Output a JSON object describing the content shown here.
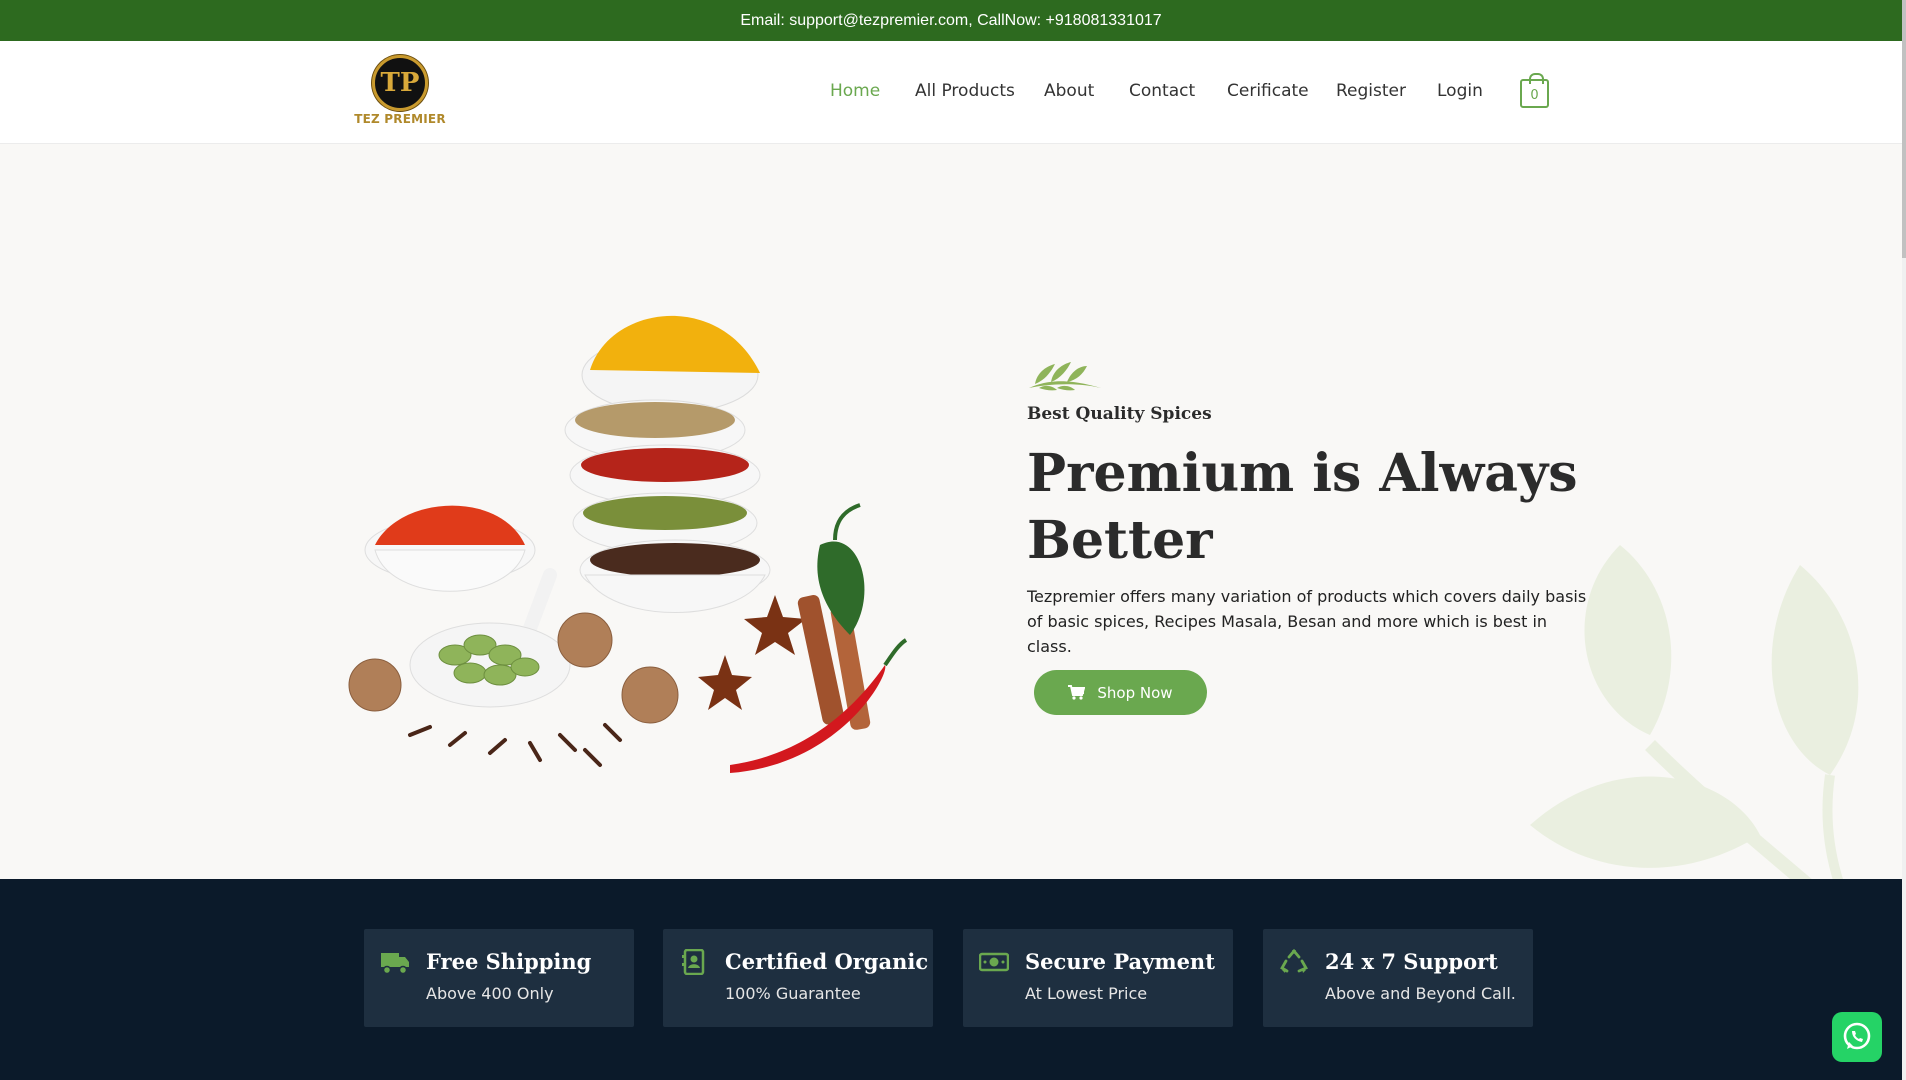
{
  "topbar": {
    "text": "Email: support@tezpremier.com, CallNow: +918081331017"
  },
  "brand": {
    "name": "TEZ PREMIER",
    "monogram": "TP"
  },
  "nav": {
    "items": [
      {
        "label": "Home",
        "active": true
      },
      {
        "label": "All Products"
      },
      {
        "label": "About"
      },
      {
        "label": "Contact"
      },
      {
        "label": "Cerificate"
      },
      {
        "label": "Register"
      },
      {
        "label": "Login"
      }
    ],
    "cart_count": "0"
  },
  "hero": {
    "subtitle": "Best Quality Spices",
    "headline": "Premium is Always Better",
    "description": "Tezpremier offers many variation of products which covers daily basis of basic spices, Recipes Masala, Besan and more which is best in class.",
    "cta_label": "Shop Now"
  },
  "features": [
    {
      "icon": "truck-icon",
      "title": "Free Shipping",
      "subtitle": "Above 400 Only"
    },
    {
      "icon": "certificate-icon",
      "title": "Certified Organic",
      "subtitle": "100% Guarantee"
    },
    {
      "icon": "money-icon",
      "title": "Secure Payment",
      "subtitle": "At Lowest Price"
    },
    {
      "icon": "recycle-icon",
      "title": "24 x 7 Support",
      "subtitle": "Above and Beyond Call."
    }
  ],
  "colors": {
    "brand_green": "#6aa84f",
    "topbar_green": "#2d6a1f",
    "footer_navy": "#0b1a2a",
    "card_navy": "#1e2f40",
    "whatsapp_green": "#25d366"
  }
}
